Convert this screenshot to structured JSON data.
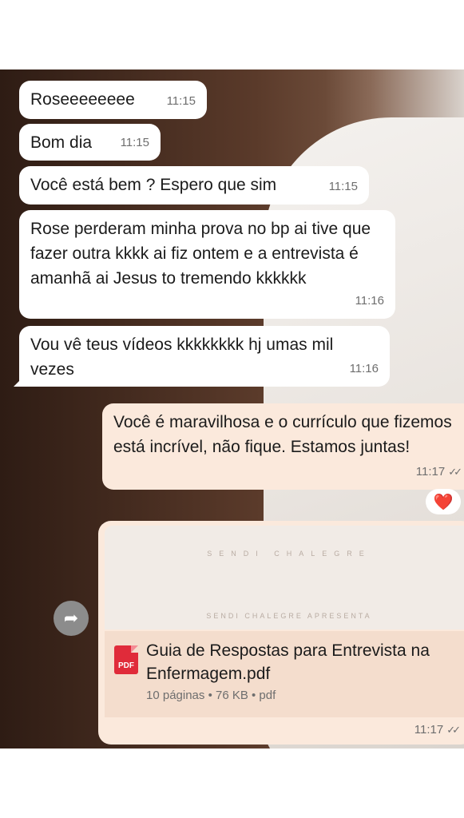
{
  "messages": [
    {
      "text": "Roseeeeeeee",
      "time": "11:15"
    },
    {
      "text": "Bom dia",
      "time": "11:15"
    },
    {
      "text": "Você está bem ? Espero que sim",
      "time": "11:15"
    },
    {
      "text": "Rose perderam minha prova no bp ai tive que fazer outra kkkk ai fiz ontem e a entrevista é amanhã ai Jesus to tremendo kkkkkk",
      "time": "11:16"
    },
    {
      "text": "Vou vê teus vídeos kkkkkkkk hj umas mil vezes",
      "time": "11:16"
    },
    {
      "text": "Você é maravilhosa e o currículo que fizemos está incrível, não fique. Estamos juntas!",
      "time": "11:17"
    }
  ],
  "reaction": "❤️",
  "document": {
    "brand_top": "SENDI CHALEGRE",
    "brand_bottom": "SENDI CHALEGRE APRESENTA",
    "icon_label": "PDF",
    "title": "Guia de Respostas para Entrevista na Enfermagem.pdf",
    "meta": "10 páginas • 76 KB • pdf",
    "time": "11:17"
  },
  "icons": {
    "share": "forward-arrow-icon",
    "chevron": "chevron-down-icon",
    "pin": "pin-icon",
    "ticks": "double-check-icon"
  },
  "colors": {
    "incoming_bubble": "#ffffff",
    "outgoing_bubble": "#fbe9dc",
    "reaction": "#e8232a",
    "pdf_icon": "#e02b3a"
  }
}
